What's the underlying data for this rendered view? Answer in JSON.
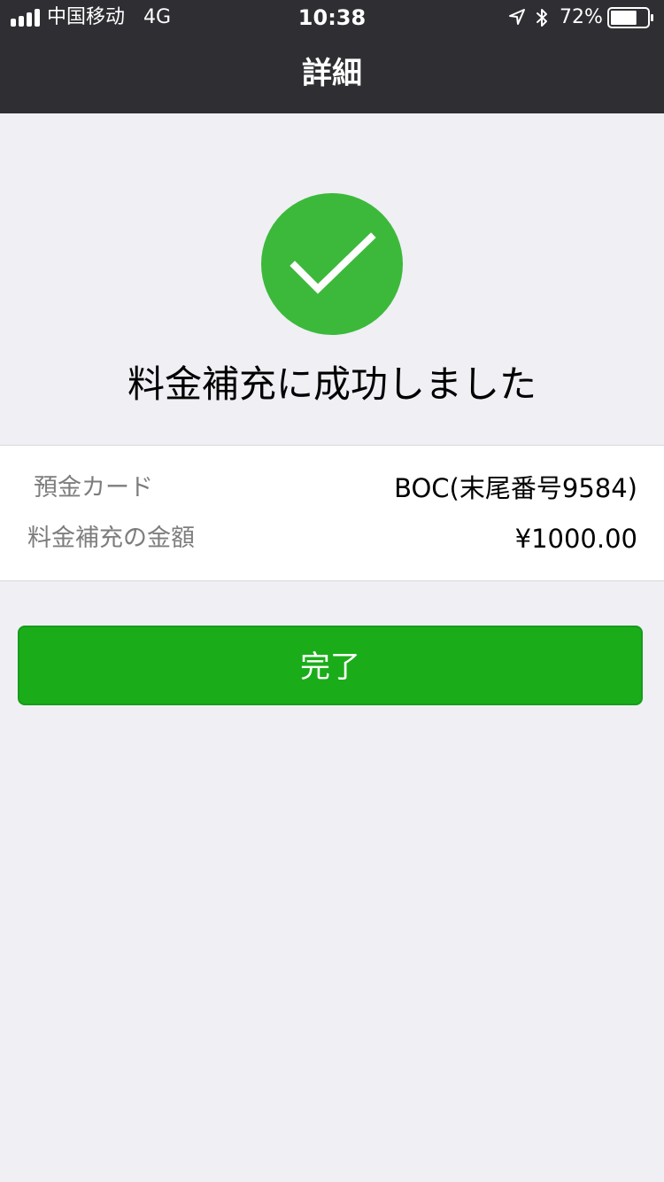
{
  "status_bar": {
    "carrier": "中国移动",
    "network": "4G",
    "time": "10:38",
    "battery_percent": "72%",
    "battery_level": 0.72,
    "signal_bars": 4,
    "icons": [
      "signal-icon",
      "location-arrow-icon",
      "bluetooth-icon",
      "battery-icon"
    ]
  },
  "nav": {
    "title": "詳細"
  },
  "result": {
    "icon": "checkmark-icon",
    "message": "料金補充に成功しました"
  },
  "details": [
    {
      "label": "預金カード",
      "value": "BOC(末尾番号9584)"
    },
    {
      "label": "料金補充の金額",
      "value": "¥1000.00"
    }
  ],
  "actions": {
    "done_label": "完了"
  },
  "colors": {
    "nav_background": "#2e2e33",
    "page_background": "#efeff4",
    "success_green": "#3cb93a",
    "button_green": "#1aad19"
  }
}
